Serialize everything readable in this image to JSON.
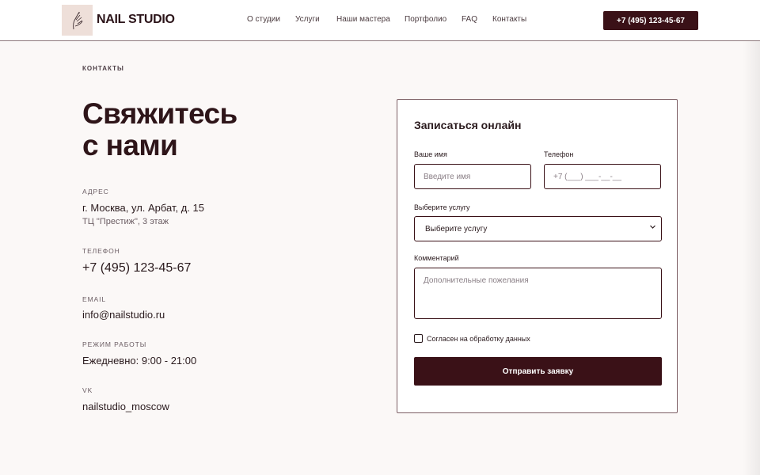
{
  "header": {
    "brand": "NAIL STUDIO",
    "nav": [
      "О студии",
      "Услуги",
      "Наши мастера",
      "Портфолио",
      "FAQ",
      "Контакты"
    ],
    "phone": "+7 (495) 123-45-67"
  },
  "section": {
    "eyebrow": "КОНТАКТЫ",
    "title_line1": "Свяжитесь",
    "title_line2": "с нами"
  },
  "contacts": {
    "address_label": "АДРЕС",
    "address": "г. Москва, ул. Арбат, д. 15",
    "address_note": "ТЦ \"Престиж\", 3 этаж",
    "phone_label": "ТЕЛЕФОН",
    "phone": "+7 (495) 123-45-67",
    "email_label": "EMAIL",
    "email": "info@nailstudio.ru",
    "hours_label": "РЕЖИМ РАБОТЫ",
    "hours": "Ежедневно: 9:00 - 21:00",
    "vk_label": "VK",
    "vk": "nailstudio_moscow"
  },
  "form": {
    "title": "Записаться онлайн",
    "name_label": "Ваше имя",
    "name_placeholder": "Введите имя",
    "phone_label": "Телефон",
    "phone_placeholder": "+7 (___) ___-__-__",
    "service_label": "Выберите услугу",
    "service_value": "Выберите услугу",
    "comment_label": "Комментарий",
    "comment_placeholder": "Дополнительные пожелания",
    "consent": "Согласен на обработку данных",
    "submit": "Отправить заявку"
  },
  "colors": {
    "brand_dark": "#3a1117",
    "background": "#fbf8f7",
    "logo_bg": "#eedfd9"
  },
  "icons": {
    "logo": "nail-hand-icon",
    "select": "chevron-down-icon"
  }
}
